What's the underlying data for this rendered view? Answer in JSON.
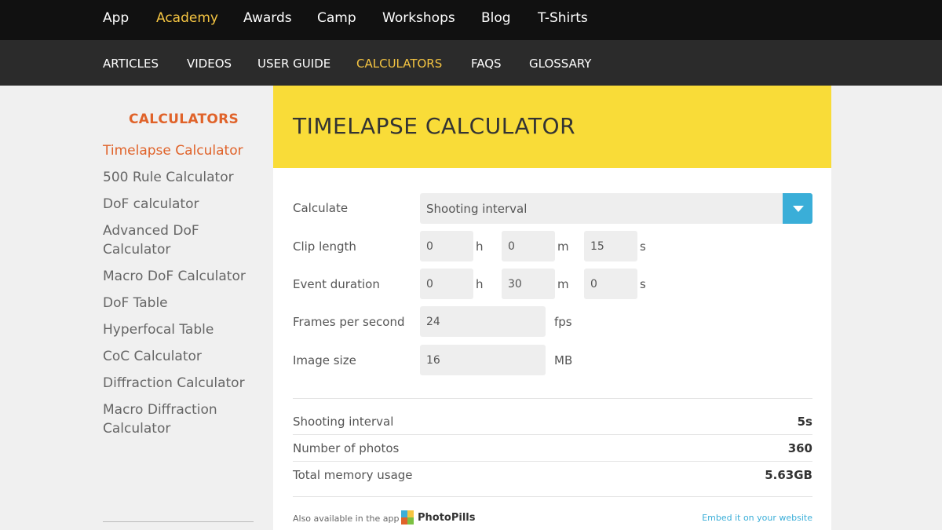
{
  "top_nav": [
    "App",
    "Academy",
    "Awards",
    "Camp",
    "Workshops",
    "Blog",
    "T-Shirts"
  ],
  "top_nav_active": "Academy",
  "sub_nav": [
    "ARTICLES",
    "VIDEOS",
    "USER GUIDE",
    "CALCULATORS",
    "FAQS",
    "GLOSSARY"
  ],
  "sub_nav_active": "CALCULATORS",
  "sidebar": {
    "title": "CALCULATORS",
    "items": [
      "Timelapse Calculator",
      "500 Rule Calculator",
      "DoF calculator",
      "Advanced DoF Calculator",
      "Macro DoF Calculator",
      "DoF Table",
      "Hyperfocal Table",
      "CoC Calculator",
      "Diffraction Calculator",
      "Macro Diffraction Calculator"
    ],
    "active_item": "Timelapse Calculator"
  },
  "calculator": {
    "title": "TIMELAPSE CALCULATOR",
    "calculate_label": "Calculate",
    "calculate_value": "Shooting interval",
    "clip_length": {
      "label": "Clip length",
      "h": "0",
      "m": "0",
      "s": "15"
    },
    "event_duration": {
      "label": "Event duration",
      "h": "0",
      "m": "30",
      "s": "0"
    },
    "fps": {
      "label": "Frames per second",
      "value": "24",
      "unit": "fps"
    },
    "image_size": {
      "label": "Image size",
      "value": "16",
      "unit": "MB"
    },
    "units": {
      "h": "h",
      "m": "m",
      "s": "s"
    },
    "results": [
      {
        "label": "Shooting interval",
        "value": "5s"
      },
      {
        "label": "Number of photos",
        "value": "360"
      },
      {
        "label": "Total memory usage",
        "value": "5.63GB"
      }
    ],
    "footer_note": "Also available in the app",
    "app_name": "PhotoPills",
    "embed_link": "Embed it on your website"
  },
  "colors": {
    "accent_yellow": "#f9dc38",
    "active_nav": "#f5c542",
    "sidebar_accent": "#e0632a",
    "select_button": "#3aaed8"
  }
}
